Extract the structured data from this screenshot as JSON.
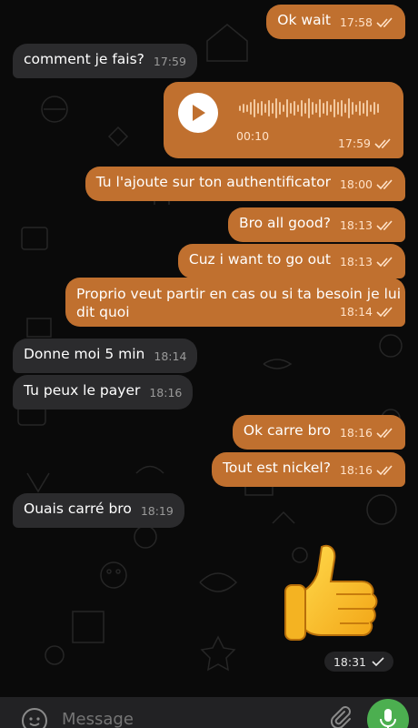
{
  "messages": [
    {
      "id": "m1",
      "side": "out",
      "text": "Ok wait",
      "time": "17:58"
    },
    {
      "id": "m2",
      "side": "in",
      "text": "comment je fais?",
      "time": "17:59"
    },
    {
      "id": "m3",
      "side": "out",
      "type": "voice",
      "duration": "00:10",
      "time": "17:59"
    },
    {
      "id": "m4",
      "side": "out",
      "text": "Tu l'ajoute sur ton authentificator",
      "time": "18:00"
    },
    {
      "id": "m5",
      "side": "out",
      "text": "Bro all good?",
      "time": "18:13"
    },
    {
      "id": "m6",
      "side": "out",
      "text": "Cuz i want to go out",
      "time": "18:13"
    },
    {
      "id": "m7",
      "side": "out",
      "text_lines": [
        "Proprio veut partir en cas ou si ta besoin je lui",
        "dit quoi"
      ],
      "time": "18:14"
    },
    {
      "id": "m8",
      "side": "in",
      "text": "Donne moi 5 min",
      "time": "18:14"
    },
    {
      "id": "m9",
      "side": "in",
      "text": "Tu peux le payer",
      "time": "18:16"
    },
    {
      "id": "m10",
      "side": "out",
      "text": "Ok carre bro",
      "time": "18:16"
    },
    {
      "id": "m11",
      "side": "out",
      "text": "Tout est nickel?",
      "time": "18:16"
    },
    {
      "id": "m12",
      "side": "in",
      "text": "Ouais carré bro",
      "time": "18:19"
    },
    {
      "id": "m13",
      "side": "out",
      "type": "sticker",
      "sticker": "thumbs-up",
      "time": "18:31"
    }
  ],
  "input": {
    "placeholder": "Message"
  },
  "colors": {
    "outgoing": "#c0702f",
    "incoming": "#2b2b2d",
    "background": "#0a0a0a",
    "mic": "#4caf50"
  }
}
